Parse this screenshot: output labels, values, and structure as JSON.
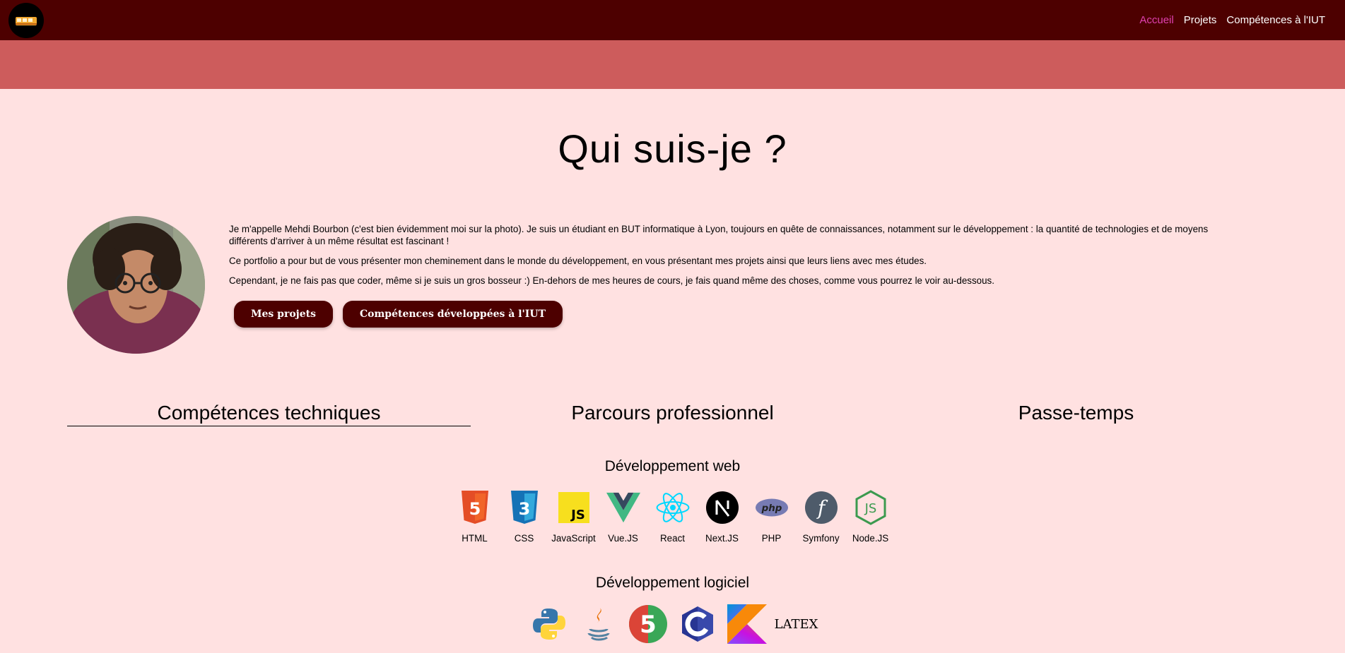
{
  "nav": {
    "logo_icon": "bus-logo-icon",
    "links": [
      "Accueil",
      "Projets",
      "Compétences à l'IUT"
    ],
    "active_color": "#e040b0"
  },
  "colors": {
    "navbar": "#4d0000",
    "banner": "#cd5c5c",
    "background": "#ffe1e1",
    "button": "#4d0000"
  },
  "hero": {
    "title": "Qui suis-je ?",
    "avatar_icon": "profile-photo",
    "paragraphs": [
      "Je m'appelle Mehdi Bourbon (c'est bien évidemment moi sur la photo). Je suis un étudiant en BUT informatique à Lyon, toujours en quête de connaissances, notamment sur le développement : la quantité de technologies et de moyens différents d'arriver à un même résultat est fascinant !",
      "Ce portfolio a pour but de vous présenter mon cheminement dans le monde du développement, en vous présentant mes projets ainsi que leurs liens avec mes études.",
      "Cependant, je ne fais pas que coder, même si je suis un gros bosseur :) En-dehors de mes heures de cours, je fais quand même des choses, comme vous pourrez le voir au-dessous."
    ],
    "buttons": [
      "Mes projets",
      "Compétences développées à l'IUT"
    ]
  },
  "tabs": [
    "Compétences techniques",
    "Parcours professionnel",
    "Passe-temps"
  ],
  "web": {
    "title": "Développement web",
    "skills": [
      {
        "label": "HTML",
        "icon": "html5-icon"
      },
      {
        "label": "CSS",
        "icon": "css3-icon"
      },
      {
        "label": "JavaScript",
        "icon": "javascript-icon"
      },
      {
        "label": "Vue.JS",
        "icon": "vuejs-icon"
      },
      {
        "label": "React",
        "icon": "react-icon"
      },
      {
        "label": "Next.JS",
        "icon": "nextjs-icon"
      },
      {
        "label": "PHP",
        "icon": "php-icon"
      },
      {
        "label": "Symfony",
        "icon": "symfony-icon"
      },
      {
        "label": "Node.JS",
        "icon": "nodejs-icon"
      }
    ]
  },
  "software": {
    "title": "Développement logiciel",
    "icons": [
      "python-icon",
      "java-icon",
      "lua5-icon",
      "c-icon",
      "kotlin-icon",
      "latex-icon"
    ],
    "latex_text": "LATEX"
  }
}
